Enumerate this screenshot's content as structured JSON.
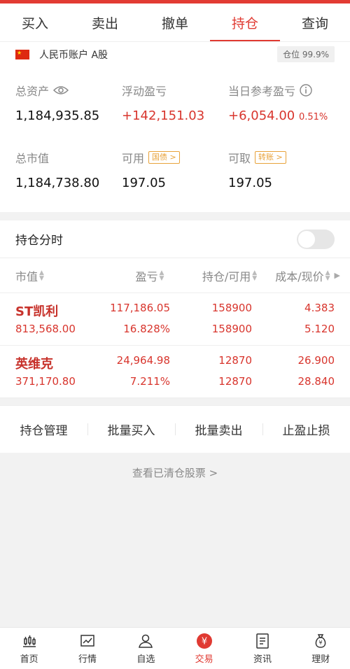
{
  "tabs": [
    "买入",
    "卖出",
    "撤单",
    "持仓",
    "查询"
  ],
  "active_tab": "持仓",
  "account": {
    "label": "人民币账户 A股",
    "position_badge": "仓位 99.9%"
  },
  "summary": {
    "total_assets_label": "总资产",
    "total_assets": "1,184,935.85",
    "float_pl_label": "浮动盈亏",
    "float_pl": "+142,151.03",
    "day_pl_label": "当日参考盈亏",
    "day_pl": "+6,054.00",
    "day_pl_pct": "0.51%",
    "market_value_label": "总市值",
    "market_value": "1,184,738.80",
    "available_label": "可用",
    "available_tag": "国债 >",
    "available": "197.05",
    "withdrawable_label": "可取",
    "withdrawable_tag": "转账 >",
    "withdrawable": "197.05"
  },
  "fenshi_label": "持仓分时",
  "table": {
    "headers": [
      "市值",
      "盈亏",
      "持仓/可用",
      "成本/现价"
    ],
    "rows": [
      {
        "name": "ST凯利",
        "market_value": "813,568.00",
        "pl": "117,186.05",
        "pl_pct": "16.828%",
        "hold": "158900",
        "avail": "158900",
        "cost": "4.383",
        "price": "5.120"
      },
      {
        "name": "英维克",
        "market_value": "371,170.80",
        "pl": "24,964.98",
        "pl_pct": "7.211%",
        "hold": "12870",
        "avail": "12870",
        "cost": "26.900",
        "price": "28.840"
      }
    ]
  },
  "actions": [
    "持仓管理",
    "批量买入",
    "批量卖出",
    "止盈止损"
  ],
  "cleared_link": "查看已清仓股票 >",
  "nav": [
    {
      "label": "首页",
      "icon": "candlestick-icon"
    },
    {
      "label": "行情",
      "icon": "chart-icon"
    },
    {
      "label": "自选",
      "icon": "user-icon"
    },
    {
      "label": "交易",
      "icon": "yuan-icon"
    },
    {
      "label": "资讯",
      "icon": "document-icon"
    },
    {
      "label": "理财",
      "icon": "money-bag-icon"
    }
  ],
  "colors": {
    "accent": "#e03a32",
    "profit": "#d8352d",
    "tag": "#e8a23a"
  }
}
